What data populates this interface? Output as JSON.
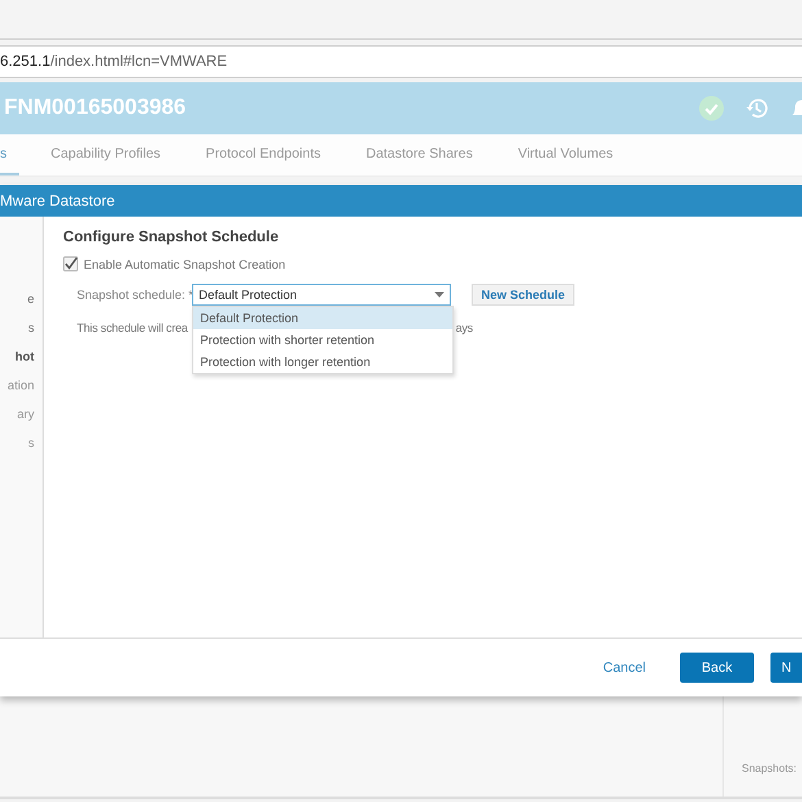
{
  "browser": {
    "address_host": "6.251.1",
    "address_path": "/index.html#lcn=VMWARE"
  },
  "app": {
    "title": "FNM00165003986",
    "status_ok": true
  },
  "tabs": [
    {
      "label": "s",
      "selected": true
    },
    {
      "label": "Capability Profiles",
      "selected": false
    },
    {
      "label": "Protocol Endpoints",
      "selected": false
    },
    {
      "label": "Datastore Shares",
      "selected": false
    },
    {
      "label": "Virtual Volumes",
      "selected": false
    }
  ],
  "dialog": {
    "title": "Mware Datastore",
    "steps": [
      {
        "label": "e",
        "selected": false,
        "disabled": false
      },
      {
        "label": "s",
        "selected": false,
        "disabled": false
      },
      {
        "label": "hot",
        "selected": true,
        "disabled": false
      },
      {
        "label": "ation",
        "selected": false,
        "disabled": true
      },
      {
        "label": "ary",
        "selected": false,
        "disabled": true
      },
      {
        "label": "s",
        "selected": false,
        "disabled": true
      }
    ],
    "heading": "Configure Snapshot Schedule",
    "enable": {
      "label": "Enable Automatic Snapshot Creation",
      "checked": true
    },
    "schedule": {
      "label": "Snapshot schedule:",
      "required_mark": "*",
      "value": "Default Protection",
      "expanded": true,
      "options": [
        {
          "label": "Default Protection",
          "selected": true
        },
        {
          "label": "Protection with shorter retention",
          "selected": false
        },
        {
          "label": "Protection with longer retention",
          "selected": false
        }
      ]
    },
    "new_button": "New Schedule",
    "description_start": "This schedule will crea",
    "description_end": "ays",
    "buttons": [
      {
        "label": "Cancel",
        "kind": "link"
      },
      {
        "label": "Back",
        "kind": "primary"
      },
      {
        "label": "N",
        "kind": "primary"
      }
    ]
  },
  "side_panel": {
    "label": "Snapshots:"
  }
}
